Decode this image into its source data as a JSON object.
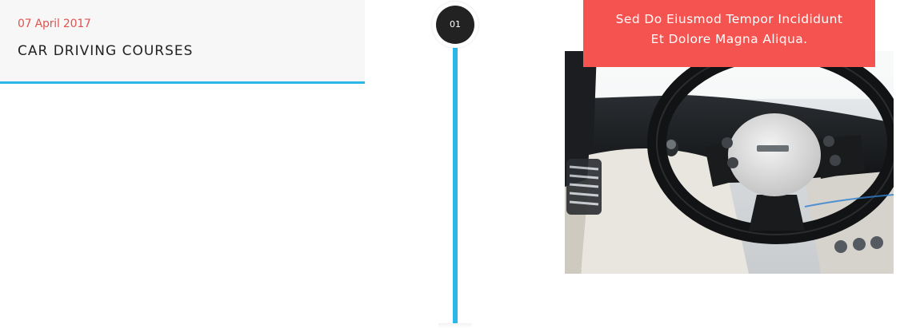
{
  "event": {
    "date": "07 April 2017",
    "title": "CAR DRIVING COURSES"
  },
  "timeline": {
    "node_label": "01"
  },
  "caption": {
    "line1": "Sed Do Eiusmod Tempor Incididunt",
    "line2": "Et Dolore Magna Aliqua."
  },
  "colors": {
    "accent_blue": "#2bb8e9",
    "accent_red": "#f55350",
    "date_red": "#e2534f",
    "node_dark": "#222222",
    "card_bg": "#f7f7f7"
  },
  "icons": {
    "photo": "steering-wheel-car-interior-photo"
  }
}
